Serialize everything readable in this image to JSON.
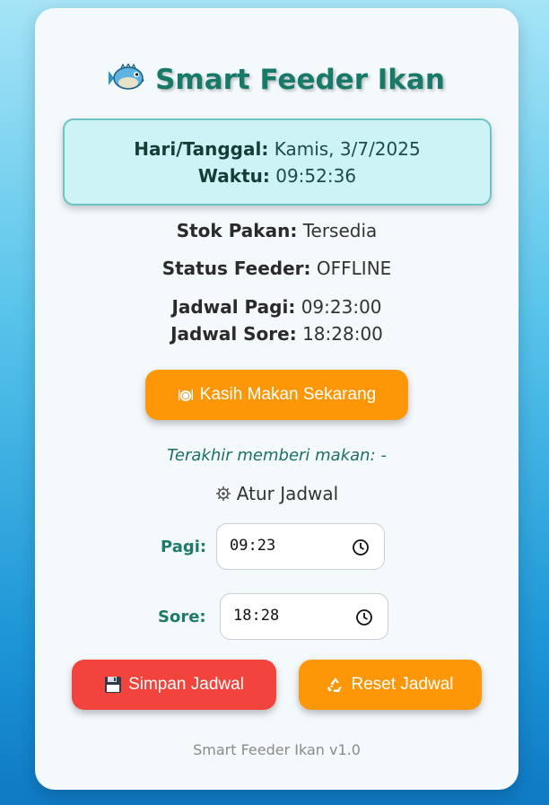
{
  "header": {
    "icon": "blowfish-icon",
    "title": "Smart Feeder Ikan"
  },
  "datetime": {
    "date_label": "Hari/Tanggal:",
    "date_value": "Kamis, 3/7/2025",
    "time_label": "Waktu:",
    "time_value": "09:52:36"
  },
  "status": {
    "stock_label": "Stok Pakan:",
    "stock_value": "Tersedia",
    "feeder_label": "Status Feeder:",
    "feeder_value": "OFFLINE",
    "morning_label": "Jadwal Pagi:",
    "morning_value": "09:23:00",
    "evening_label": "Jadwal Sore:",
    "evening_value": "18:28:00"
  },
  "feed_button": {
    "icon": "plate-icon",
    "label": "Kasih Makan Sekarang"
  },
  "last_fed": "Terakhir memberi makan: -",
  "schedule": {
    "title_icon": "gear-icon",
    "title": "Atur Jadwal",
    "morning_label": "Pagi:",
    "morning_value": "09:23",
    "evening_label": "Sore:",
    "evening_value": "18:28"
  },
  "buttons": {
    "save_icon": "floppy-disk-icon",
    "save_label": "Simpan Jadwal",
    "reset_icon": "recycle-icon",
    "reset_label": "Reset Jadwal"
  },
  "footer": "Smart Feeder Ikan v1.0",
  "colors": {
    "accent_teal": "#177a69",
    "orange": "#fd9707",
    "red": "#f2433c"
  }
}
